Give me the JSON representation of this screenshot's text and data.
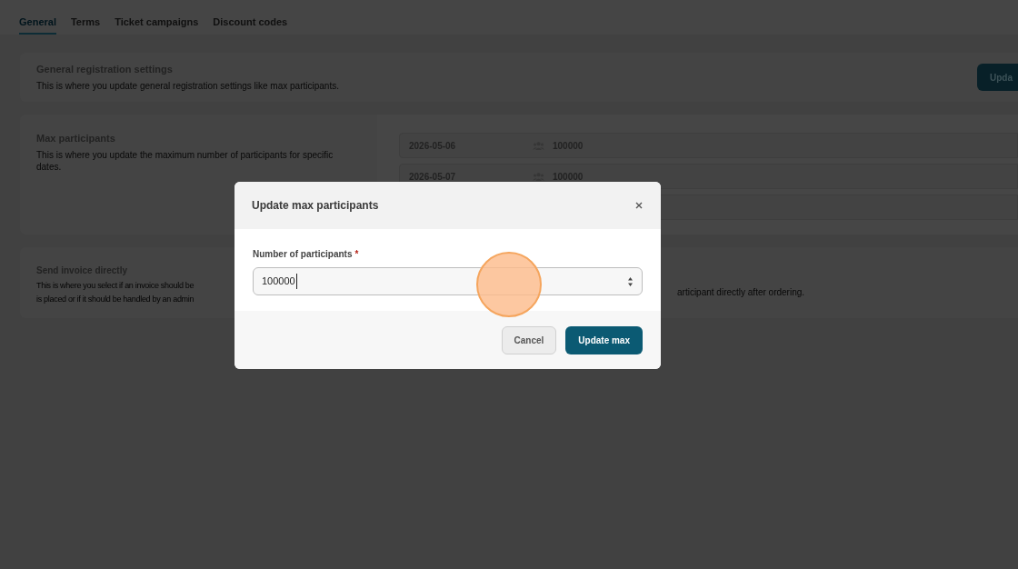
{
  "tabs": [
    {
      "label": "General",
      "selected": true
    },
    {
      "label": "Terms",
      "selected": false
    },
    {
      "label": "Ticket campaigns",
      "selected": false
    },
    {
      "label": "Discount codes",
      "selected": false
    }
  ],
  "general_settings": {
    "title": "General registration settings",
    "description": "This is where you update general registration settings like max participants.",
    "button": "Upda"
  },
  "max_participants": {
    "title": "Max participants",
    "description": "This is where you update the maximum number of participants for specific dates.",
    "dates": [
      {
        "date": "2026-05-06",
        "count": "100000"
      },
      {
        "date": "2026-05-07",
        "count": "100000"
      }
    ]
  },
  "send_invoice": {
    "title": "Send invoice directly",
    "description_lines": [
      "This is where you select if an invoice should be",
      "is placed or if it should be handled by an admin"
    ],
    "right_text": "articipant directly after ordering."
  },
  "dialog": {
    "title": "Update max participants",
    "field_label": "Number of participants",
    "required_mark": "*",
    "value": "100000",
    "cancel": "Cancel",
    "submit": "Update max"
  }
}
